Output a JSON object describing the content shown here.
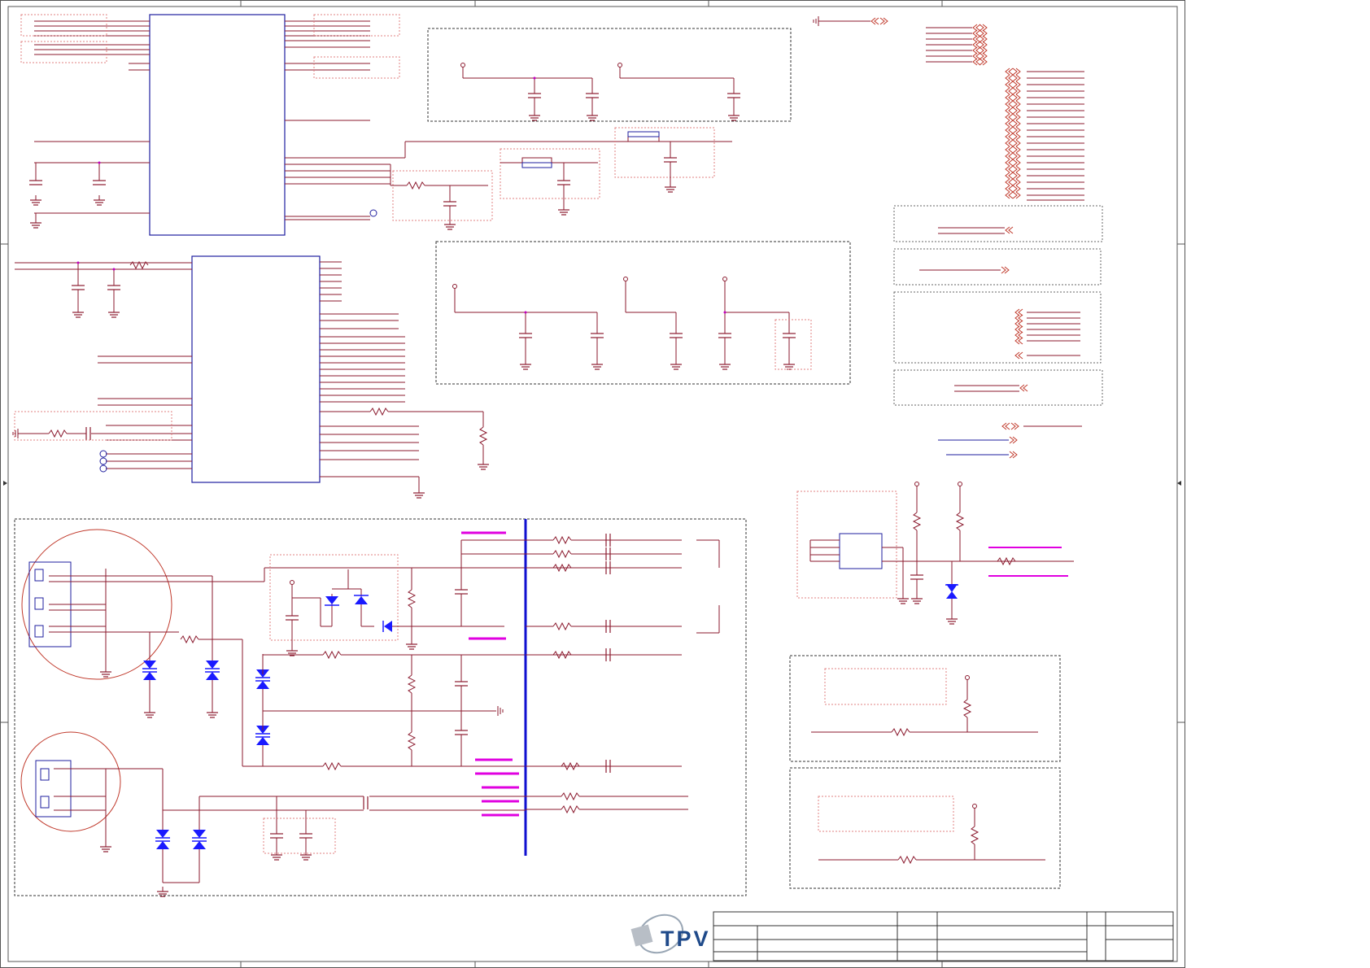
{
  "brand": {
    "logo_text": "TPV"
  },
  "colors": {
    "frame": "#555555",
    "wire": "#8b1a2e",
    "ic_border": "#1f1f9f",
    "signal_red": "#c0392b",
    "dashed_box": "#333333",
    "sub_box": "#e08080",
    "diode": "#1a1aff",
    "bus": "#1010d0",
    "net_label": "#e000e0"
  },
  "icons": {
    "logo": "tpv-logo",
    "ground": "ground-symbol",
    "capacitor": "capacitor-symbol",
    "resistor": "resistor-symbol",
    "inductor": "inductor-symbol",
    "diode": "tvs-diode-symbol",
    "connector": "av-jack-symbol",
    "offpage": "offpage-connector-arrow"
  }
}
